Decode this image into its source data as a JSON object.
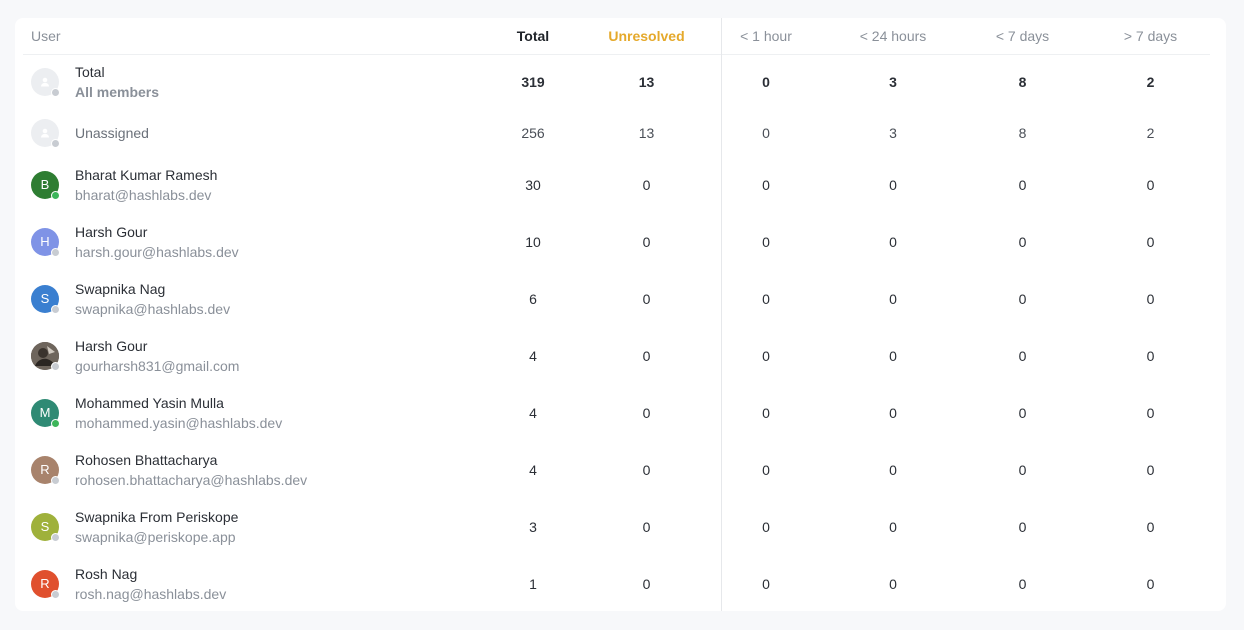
{
  "headers": {
    "user": "User",
    "total": "Total",
    "unresolved": "Unresolved",
    "lt1h": "< 1 hour",
    "lt24h": "< 24 hours",
    "lt7d": "< 7 days",
    "gt7d": "> 7 days"
  },
  "summary": {
    "name": "Total",
    "sub": "All members",
    "total": "319",
    "unresolved": "13",
    "lt1h": "0",
    "lt24h": "3",
    "lt7d": "8",
    "gt7d": "2"
  },
  "unassigned": {
    "name": "Unassigned",
    "total": "256",
    "unresolved": "13",
    "lt1h": "0",
    "lt24h": "3",
    "lt7d": "8",
    "gt7d": "2"
  },
  "users": [
    {
      "name": "Bharat Kumar Ramesh",
      "email": "bharat@hashlabs.dev",
      "initial": "B",
      "color": "#2e7d32",
      "online": true,
      "total": "30",
      "unresolved": "0",
      "lt1h": "0",
      "lt24h": "0",
      "lt7d": "0",
      "gt7d": "0"
    },
    {
      "name": "Harsh Gour",
      "email": "harsh.gour@hashlabs.dev",
      "initial": "H",
      "color": "#7f93e6",
      "online": false,
      "total": "10",
      "unresolved": "0",
      "lt1h": "0",
      "lt24h": "0",
      "lt7d": "0",
      "gt7d": "0"
    },
    {
      "name": "Swapnika Nag",
      "email": "swapnika@hashlabs.dev",
      "initial": "S",
      "color": "#3a7fd0",
      "online": false,
      "total": "6",
      "unresolved": "0",
      "lt1h": "0",
      "lt24h": "0",
      "lt7d": "0",
      "gt7d": "0"
    },
    {
      "name": "Harsh Gour",
      "email": "gourharsh831@gmail.com",
      "initial": "",
      "color": "#5a5046",
      "online": false,
      "total": "4",
      "unresolved": "0",
      "lt1h": "0",
      "lt24h": "0",
      "lt7d": "0",
      "gt7d": "0"
    },
    {
      "name": "Mohammed Yasin Mulla",
      "email": "mohammed.yasin@hashlabs.dev",
      "initial": "M",
      "color": "#2f8a74",
      "online": true,
      "total": "4",
      "unresolved": "0",
      "lt1h": "0",
      "lt24h": "0",
      "lt7d": "0",
      "gt7d": "0"
    },
    {
      "name": "Rohosen Bhattacharya",
      "email": "rohosen.bhattacharya@hashlabs.dev",
      "initial": "R",
      "color": "#a8836c",
      "online": false,
      "total": "4",
      "unresolved": "0",
      "lt1h": "0",
      "lt24h": "0",
      "lt7d": "0",
      "gt7d": "0"
    },
    {
      "name": "Swapnika From Periskope",
      "email": "swapnika@periskope.app",
      "initial": "S",
      "color": "#9fb13b",
      "online": false,
      "total": "3",
      "unresolved": "0",
      "lt1h": "0",
      "lt24h": "0",
      "lt7d": "0",
      "gt7d": "0"
    },
    {
      "name": "Rosh Nag",
      "email": "rosh.nag@hashlabs.dev",
      "initial": "R",
      "color": "#e0502e",
      "online": false,
      "total": "1",
      "unresolved": "0",
      "lt1h": "0",
      "lt24h": "0",
      "lt7d": "0",
      "gt7d": "0"
    }
  ]
}
